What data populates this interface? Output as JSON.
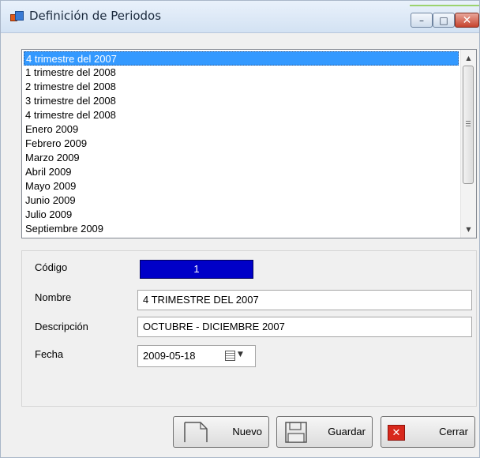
{
  "window": {
    "title": "Definición de Periodos",
    "controls": {
      "minimize": "minimize-icon",
      "maximize": "maximize-icon",
      "close": "close-icon"
    }
  },
  "periods_list": {
    "items": [
      "4 trimestre del 2007",
      "1 trimestre del 2008",
      "2 trimestre del 2008",
      "3 trimestre del 2008",
      "4 trimestre del 2008",
      "Enero 2009",
      "Febrero 2009",
      "Marzo 2009",
      "Abril 2009",
      "Mayo 2009",
      "Junio 2009",
      "Julio 2009",
      "Septiembre 2009"
    ],
    "selected_index": 0
  },
  "form": {
    "codigo_label": "Código",
    "codigo_value": "1",
    "nombre_label": "Nombre",
    "nombre_value": "4 TRIMESTRE DEL 2007",
    "descripcion_label": "Descripción",
    "descripcion_value": "OCTUBRE - DICIEMBRE 2007",
    "fecha_label": "Fecha",
    "fecha_value": "2009-05-18"
  },
  "buttons": {
    "nuevo": "Nuevo",
    "guardar": "Guardar",
    "cerrar": "Cerrar"
  },
  "colors": {
    "selection": "#3399ff",
    "codigo_bg": "#0000c8",
    "close_button": "#d8281c"
  }
}
